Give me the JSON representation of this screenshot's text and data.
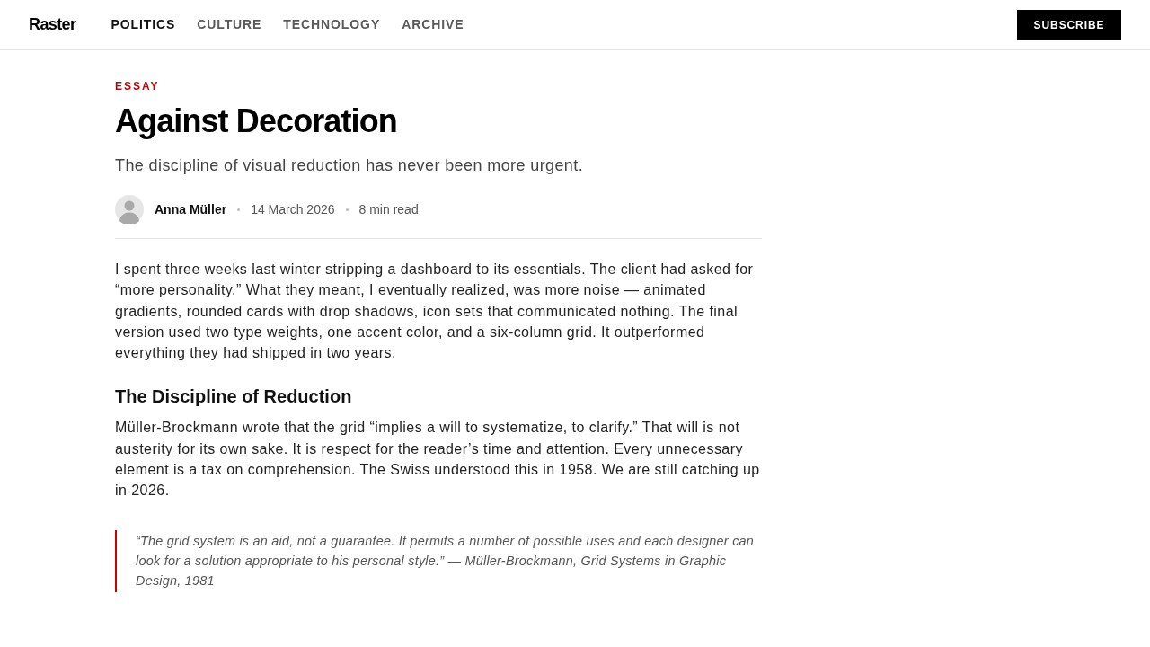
{
  "header": {
    "logo": "Raster",
    "nav": [
      {
        "label": "POLITICS",
        "selected": true
      },
      {
        "label": "CULTURE",
        "selected": false
      },
      {
        "label": "TECHNOLOGY",
        "selected": false
      },
      {
        "label": "ARCHIVE",
        "selected": false
      }
    ],
    "subscribe": "SUBSCRIBE"
  },
  "article": {
    "category": "ESSAY",
    "title": "Against Decoration",
    "subtitle": "The discipline of visual reduction has never been more urgent.",
    "author": "Anna Müller",
    "date": "14 March 2026",
    "read_time": "8 min read",
    "body": [
      {
        "kind": "paragraph",
        "text": "I spent three weeks last winter stripping a dashboard to its essentials. The client had asked for “more personality.” What they meant, I eventually realized, was more noise — animated gradients, rounded cards with drop shadows, icon sets that communicated nothing. The final version used two type weights, one accent color, and a six-column grid. It outperformed everything they had shipped in two years."
      },
      {
        "kind": "heading",
        "text": "The Discipline of Reduction"
      },
      {
        "kind": "paragraph",
        "text": "Müller-Brockmann wrote that the grid “implies a will to systematize, to clarify.” That will is not austerity for its own sake. It is respect for the reader’s time and attention. Every unnecessary element is a tax on comprehension. The Swiss understood this in 1958. We are still catching up in 2026."
      },
      {
        "kind": "quote",
        "text": "“The grid system is an aid, not a guarantee. It permits a number of possible uses and each designer can look for a solution appropriate to his personal style.” — Müller-Brockmann, Grid Systems in Graphic Design, 1981"
      }
    ]
  }
}
